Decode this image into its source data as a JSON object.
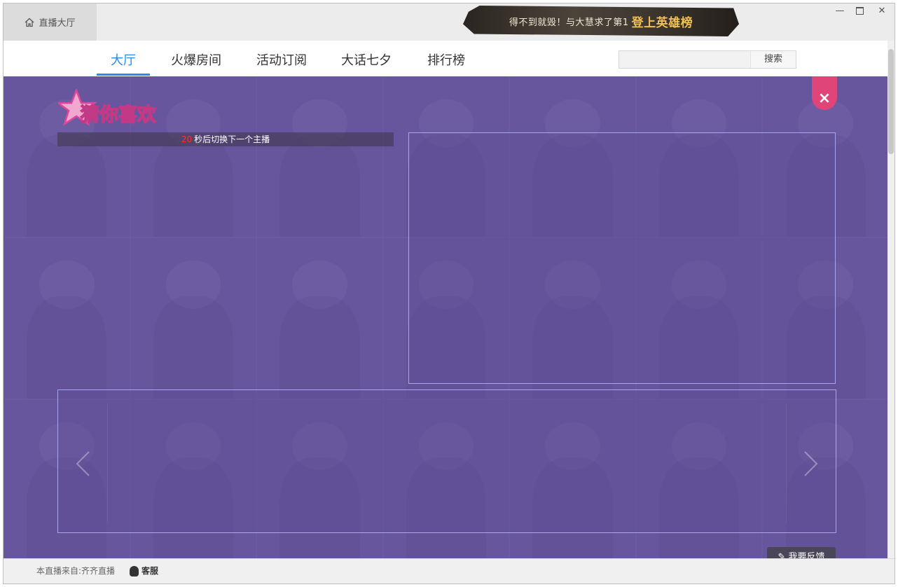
{
  "titlebar": {
    "home_tab_label": "直播大厅",
    "banner_text": "得不到就毁！与大慧求了第1",
    "banner_highlight": "登上英雄榜"
  },
  "window_controls": {
    "minimize_icon": "minimize-icon",
    "maximize_icon": "maximize-icon",
    "close_icon": "close-icon"
  },
  "nav": {
    "tabs": [
      {
        "label": "大厅",
        "active": true
      },
      {
        "label": "火爆房间",
        "active": false
      },
      {
        "label": "活动订阅",
        "active": false
      },
      {
        "label": "大话七夕",
        "active": false
      },
      {
        "label": "排行榜",
        "active": false
      }
    ],
    "search_placeholder": "",
    "search_button": "搜索"
  },
  "recommend": {
    "logo_text": "猜你喜欢",
    "countdown_number": "20",
    "countdown_text": "秒后切换下一个主播",
    "close_label": "×"
  },
  "carousel": {
    "prev_icon": "chevron-left-icon",
    "next_icon": "chevron-right-icon"
  },
  "feedback": {
    "label": "我要反馈"
  },
  "status": {
    "source_text": "本直播来自:齐齐直播",
    "service_text": "客服"
  },
  "colors": {
    "accent": "#2c8ae8",
    "overlay": "#6a5c9b",
    "close": "#e0457a",
    "countdown_number": "#ff3030"
  }
}
